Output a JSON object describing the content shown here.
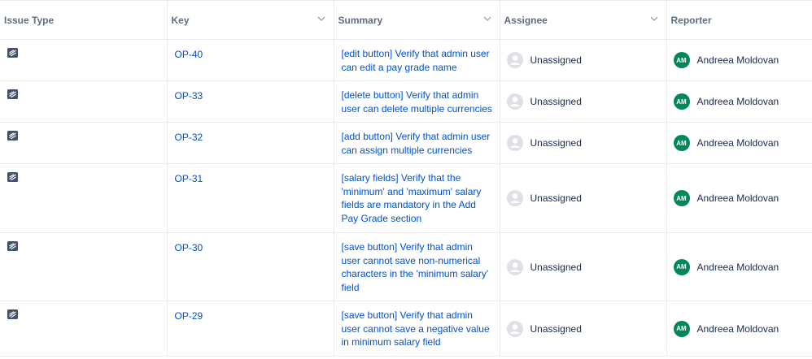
{
  "columns": [
    {
      "label": "Issue Type",
      "has_menu": false
    },
    {
      "label": "Key",
      "has_menu": true
    },
    {
      "label": "Summary",
      "has_menu": true
    },
    {
      "label": "Assignee",
      "has_menu": true
    },
    {
      "label": "Reporter",
      "has_menu": false
    }
  ],
  "rows": [
    {
      "type_icon": "test-issue-icon",
      "key": "OP-40",
      "summary": "[edit button] Verify that admin user can edit a pay grade name",
      "assignee": "Unassigned",
      "reporter": "Andreea Moldovan",
      "reporter_initials": "AM"
    },
    {
      "type_icon": "test-issue-icon",
      "key": "OP-33",
      "summary": "[delete button] Verify that admin user can delete multiple currencies",
      "assignee": "Unassigned",
      "reporter": "Andreea Moldovan",
      "reporter_initials": "AM"
    },
    {
      "type_icon": "test-issue-icon",
      "key": "OP-32",
      "summary": "[add button] Verify that admin user can assign multiple currencies",
      "assignee": "Unassigned",
      "reporter": "Andreea Moldovan",
      "reporter_initials": "AM"
    },
    {
      "type_icon": "test-issue-icon",
      "key": "OP-31",
      "summary": "[salary fields] Verify that the 'minimum' and 'maximum' salary fields are mandatory in the Add Pay Grade section",
      "assignee": "Unassigned",
      "reporter": "Andreea Moldovan",
      "reporter_initials": "AM"
    },
    {
      "type_icon": "test-issue-icon",
      "key": "OP-30",
      "summary": "[save button] Verify that admin user cannot save non-numerical characters in the 'minimum salary' field",
      "assignee": "Unassigned",
      "reporter": "Andreea Moldovan",
      "reporter_initials": "AM"
    },
    {
      "type_icon": "test-issue-icon",
      "key": "OP-29",
      "summary": "[save button] Verify that admin user cannot save a negative value in minimum salary field",
      "assignee": "Unassigned",
      "reporter": "Andreea Moldovan",
      "reporter_initials": "AM"
    }
  ],
  "colors": {
    "link": "#0052cc",
    "reporter_avatar": "#00875a",
    "header_text": "#5e6c84"
  }
}
